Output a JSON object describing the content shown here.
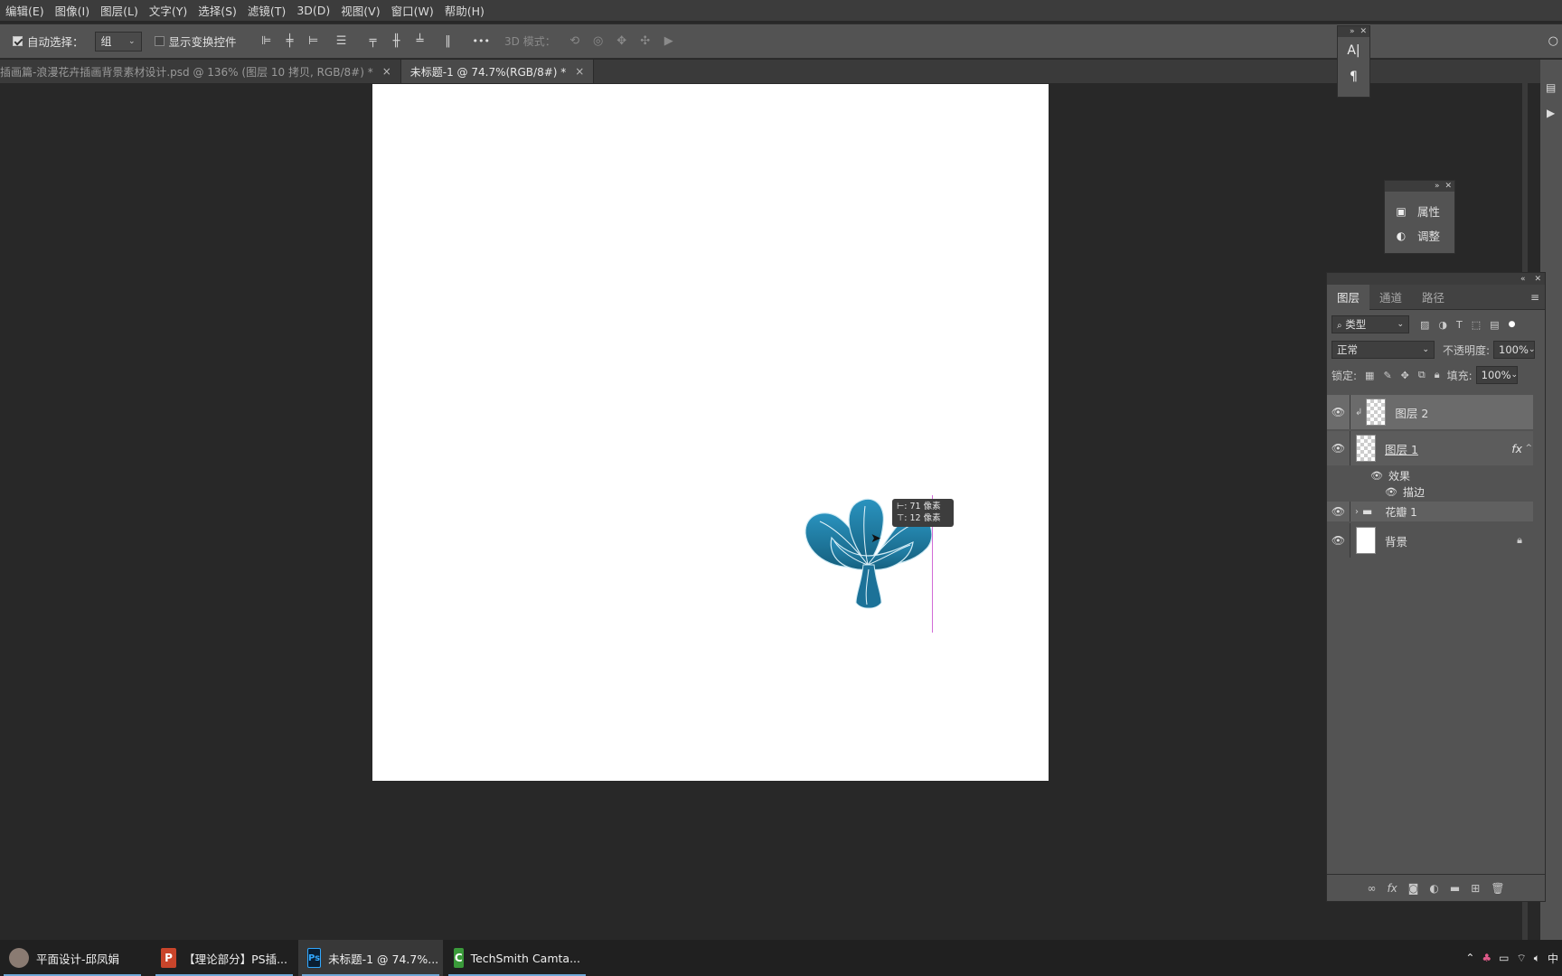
{
  "menubar": {
    "items": [
      "编辑(E)",
      "图像(I)",
      "图层(L)",
      "文字(Y)",
      "选择(S)",
      "滤镜(T)",
      "3D(D)",
      "视图(V)",
      "窗口(W)",
      "帮助(H)"
    ]
  },
  "options_bar": {
    "auto_select_label": "自动选择：",
    "auto_select_value": "组",
    "show_transform_label": "显示变换控件",
    "more_label": "•••",
    "mode_3d_label": "3D 模式："
  },
  "tabs": [
    {
      "label": "插画篇-浪漫花卉插画背景素材设计.psd @ 136% (图层 10 拷贝, RGB/8#) *",
      "close": "×"
    },
    {
      "label": "未标题-1 @ 74.7%(RGB/8#) *",
      "close": "×"
    }
  ],
  "tooltip": {
    "line1": "⊢: 71 像素",
    "line2": "⊤: 12 像素"
  },
  "char_panel": {
    "char_icon": "A|",
    "para_icon": "¶"
  },
  "props_panel": {
    "properties_label": "属性",
    "adjustments_label": "调整"
  },
  "layers_panel": {
    "tabs": [
      "图层",
      "通道",
      "路径"
    ],
    "filter_label": "类型",
    "blend_mode": "正常",
    "opacity_label": "不透明度:",
    "opacity_value": "100%",
    "lock_label": "锁定:",
    "fill_label": "填充:",
    "fill_value": "100%",
    "layers": [
      {
        "name": "图层 2"
      },
      {
        "name": "图层 1",
        "fx": "fx"
      },
      {
        "name": "效果"
      },
      {
        "name": "描边"
      },
      {
        "name": "花瓣 1"
      },
      {
        "name": "背景"
      }
    ]
  },
  "taskbar": {
    "items": [
      {
        "label": "平面设计-邱凤娟",
        "icon": "avatar"
      },
      {
        "label": "【理论部分】PS插...",
        "icon": "P"
      },
      {
        "label": "未标题-1 @ 74.7%...",
        "icon": "Ps"
      },
      {
        "label": "TechSmith Camta...",
        "icon": "C"
      }
    ],
    "ime": "中"
  },
  "colors": {
    "petal": "#1f7ea6",
    "petal_dark": "#15607f",
    "guide": "#d16cd6"
  }
}
